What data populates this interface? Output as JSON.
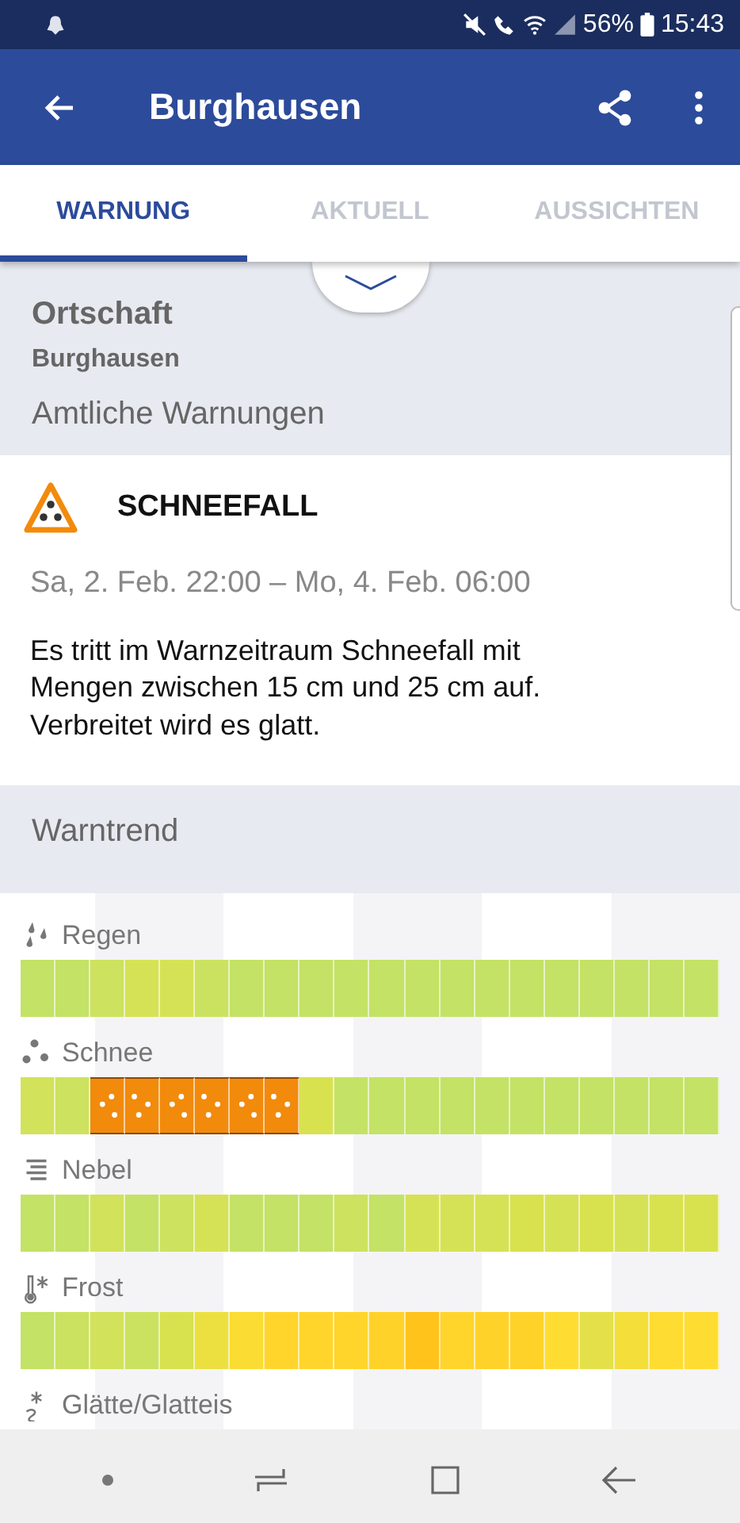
{
  "status_bar": {
    "battery": "56%",
    "time": "15:43"
  },
  "app_bar": {
    "title": "Burghausen"
  },
  "tabs": [
    {
      "label": "WARNUNG",
      "selected": true
    },
    {
      "label": "AKTUELL",
      "selected": false
    },
    {
      "label": "AUSSICHTEN",
      "selected": false
    }
  ],
  "location": {
    "heading": "Ortschaft",
    "name": "Burghausen",
    "section": "Amtliche Warnungen"
  },
  "warning": {
    "title": "SCHNEEFALL",
    "period": "Sa, 2. Feb. 22:00 – Mo, 4. Feb. 06:00",
    "text": "Es tritt im Warnzeitraum Schneefall mit Mengen zwischen 15 cm und 25 cm auf. Verbreitet wird es glatt."
  },
  "trend": {
    "heading": "Warntrend",
    "rows": [
      {
        "kind": "rain",
        "label": "Regen",
        "cells": [
          {
            "color": "#c4e266"
          },
          {
            "color": "#c4e266"
          },
          {
            "color": "#cde25e"
          },
          {
            "color": "#d6e255"
          },
          {
            "color": "#d6e255"
          },
          {
            "color": "#cbe260"
          },
          {
            "color": "#c4e266"
          },
          {
            "color": "#c4e266"
          },
          {
            "color": "#c4e266"
          },
          {
            "color": "#c4e266"
          },
          {
            "color": "#c4e266"
          },
          {
            "color": "#c4e266"
          },
          {
            "color": "#c4e266"
          },
          {
            "color": "#c4e266"
          },
          {
            "color": "#c4e266"
          },
          {
            "color": "#c4e266"
          },
          {
            "color": "#c4e266"
          },
          {
            "color": "#c4e266"
          },
          {
            "color": "#c4e266"
          },
          {
            "color": "#c4e266"
          }
        ]
      },
      {
        "kind": "snow",
        "label": "Schnee",
        "cells": [
          {
            "color": "#d2e25a"
          },
          {
            "color": "#cde25e"
          },
          {
            "color": "#f28a0c",
            "kind": "warning"
          },
          {
            "color": "#f28a0c",
            "kind": "warning"
          },
          {
            "color": "#f28a0c",
            "kind": "warning"
          },
          {
            "color": "#f28a0c",
            "kind": "warning"
          },
          {
            "color": "#f28a0c",
            "kind": "warning"
          },
          {
            "color": "#f28a0c",
            "kind": "warning"
          },
          {
            "color": "#d8e24f"
          },
          {
            "color": "#c4e266"
          },
          {
            "color": "#c4e266"
          },
          {
            "color": "#c4e266"
          },
          {
            "color": "#c4e266"
          },
          {
            "color": "#c4e266"
          },
          {
            "color": "#c4e266"
          },
          {
            "color": "#c4e266"
          },
          {
            "color": "#c4e266"
          },
          {
            "color": "#c4e266"
          },
          {
            "color": "#c4e266"
          },
          {
            "color": "#c4e266"
          }
        ]
      },
      {
        "kind": "fog",
        "label": "Nebel",
        "cells": [
          {
            "color": "#c4e266"
          },
          {
            "color": "#c4e266"
          },
          {
            "color": "#d2e25a"
          },
          {
            "color": "#c4e266"
          },
          {
            "color": "#cde25e"
          },
          {
            "color": "#d6e255"
          },
          {
            "color": "#c4e266"
          },
          {
            "color": "#c4e266"
          },
          {
            "color": "#c4e266"
          },
          {
            "color": "#cde25e"
          },
          {
            "color": "#c4e266"
          },
          {
            "color": "#d6e255"
          },
          {
            "color": "#d6e255"
          },
          {
            "color": "#d6e255"
          },
          {
            "color": "#d8e24f"
          },
          {
            "color": "#d6e255"
          },
          {
            "color": "#d8e24f"
          },
          {
            "color": "#d6e255"
          },
          {
            "color": "#d8e24f"
          },
          {
            "color": "#d8e24f"
          }
        ]
      },
      {
        "kind": "frost",
        "label": "Frost",
        "cells": [
          {
            "color": "#c4e266"
          },
          {
            "color": "#cbe260"
          },
          {
            "color": "#d2e25a"
          },
          {
            "color": "#cbe260"
          },
          {
            "color": "#d8e24f"
          },
          {
            "color": "#ece040"
          },
          {
            "color": "#fbdc32"
          },
          {
            "color": "#ffd52c"
          },
          {
            "color": "#ffd52c"
          },
          {
            "color": "#ffd52c"
          },
          {
            "color": "#ffd22a"
          },
          {
            "color": "#ffc31c"
          },
          {
            "color": "#ffd52c"
          },
          {
            "color": "#ffd22a"
          },
          {
            "color": "#ffd22a"
          },
          {
            "color": "#ffdc32"
          },
          {
            "color": "#e4e04a"
          },
          {
            "color": "#f4de3a"
          },
          {
            "color": "#ffdc32"
          },
          {
            "color": "#ffdc32"
          }
        ]
      },
      {
        "kind": "ice",
        "label": "Glätte/Glatteis"
      }
    ]
  }
}
